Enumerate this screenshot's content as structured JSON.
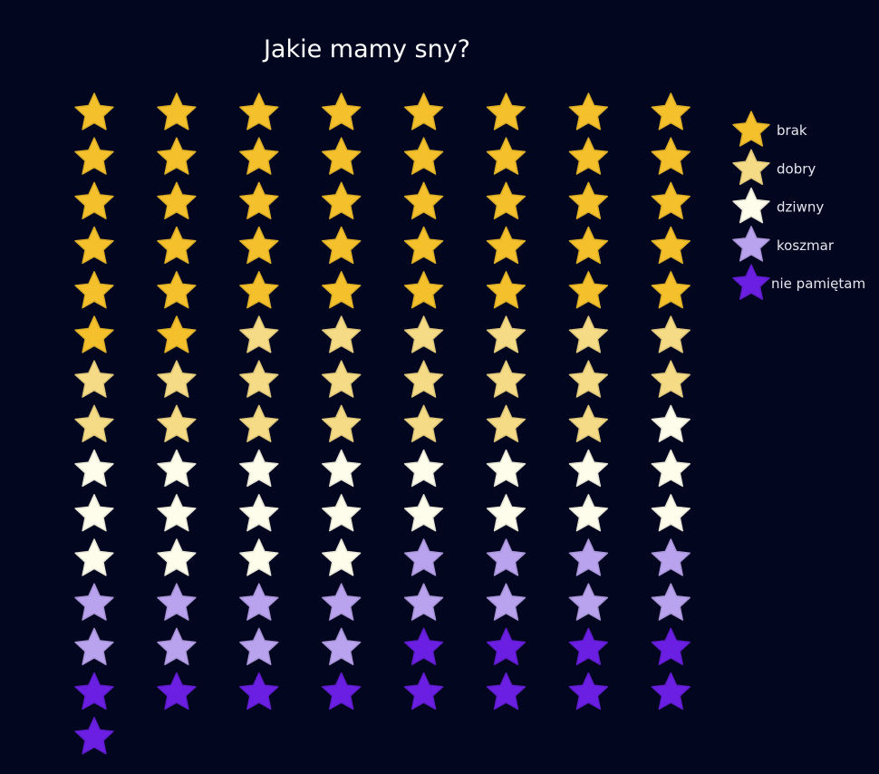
{
  "chart_data": {
    "type": "waffle",
    "title": "Jakie mamy sny?",
    "icon": "star-icon",
    "columns": 8,
    "categories": [
      {
        "label": "brak",
        "count": 42,
        "color": "#f4c02b"
      },
      {
        "label": "dobry",
        "count": 21,
        "color": "#f6db86"
      },
      {
        "label": "dziwny",
        "count": 21,
        "color": "#fefceb"
      },
      {
        "label": "koszmar",
        "count": 16,
        "color": "#b9a3ee"
      },
      {
        "label": "nie pamiętam",
        "count": 13,
        "color": "#6b1fe3"
      }
    ],
    "legend_position": "right"
  }
}
